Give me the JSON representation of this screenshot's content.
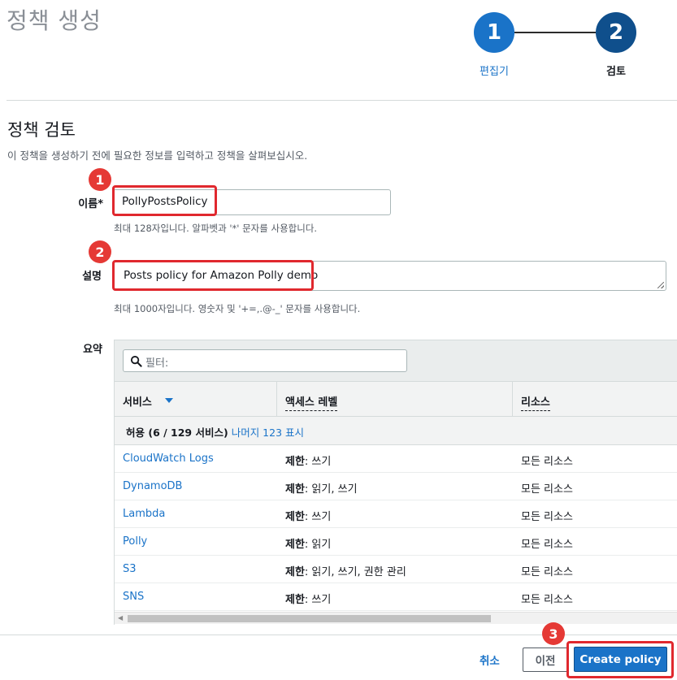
{
  "page": {
    "title": "정책 생성"
  },
  "steps": [
    {
      "number": "1",
      "label": "편집기"
    },
    {
      "number": "2",
      "label": "검토"
    }
  ],
  "review": {
    "title": "정책 검토",
    "description": "이 정책을 생성하기 전에 필요한 정보를 입력하고 정책을 살펴보십시오."
  },
  "form": {
    "name_label": "이름*",
    "name_value": "PollyPostsPolicy",
    "name_hint": "최대 128자입니다. 알파벳과 '*' 문자를 사용합니다.",
    "desc_label": "설명",
    "desc_value": "Posts policy for Amazon Polly demo",
    "desc_hint": "최대 1000자입니다. 영숫자 및 '+=,.@-_' 문자를 사용합니다.",
    "summary_label": "요약"
  },
  "annotations": [
    "1",
    "2",
    "3"
  ],
  "summary_table": {
    "filter_placeholder": "필터:",
    "columns": [
      "서비스",
      "액세스 레벨",
      "리소스"
    ],
    "group": {
      "prefix": "허용 (6 / 129 서비스)",
      "link": "나머지 123 표시"
    },
    "rows": [
      {
        "service": "CloudWatch Logs",
        "access_bold": "제한",
        "access_rest": ": 쓰기",
        "resource": "모든 리소스"
      },
      {
        "service": "DynamoDB",
        "access_bold": "제한",
        "access_rest": ": 읽기, 쓰기",
        "resource": "모든 리소스"
      },
      {
        "service": "Lambda",
        "access_bold": "제한",
        "access_rest": ": 쓰기",
        "resource": "모든 리소스"
      },
      {
        "service": "Polly",
        "access_bold": "제한",
        "access_rest": ": 읽기",
        "resource": "모든 리소스"
      },
      {
        "service": "S3",
        "access_bold": "제한",
        "access_rest": ": 읽기, 쓰기, 권한 관리",
        "resource": "모든 리소스"
      },
      {
        "service": "SNS",
        "access_bold": "제한",
        "access_rest": ": 쓰기",
        "resource": "모든 리소스"
      }
    ]
  },
  "footer": {
    "cancel_label": "취소",
    "prev_label": "이전",
    "create_label": "Create policy"
  },
  "colors": {
    "accent": "#1a73c8",
    "annotation": "#e0282e"
  }
}
